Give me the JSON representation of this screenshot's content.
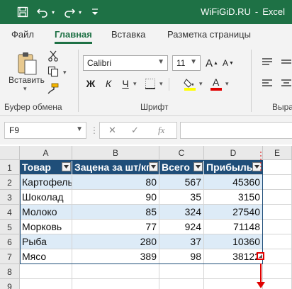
{
  "titlebar": {
    "app_name": "WiFiGiD.RU",
    "separator": "-",
    "program": "Excel"
  },
  "tabs": [
    "Файл",
    "Главная",
    "Вставка",
    "Разметка страницы"
  ],
  "ribbon": {
    "paste_label": "Вставить",
    "clipboard_group": "Буфер обмена",
    "font_group": "Шрифт",
    "align_group_partial": "Выра",
    "font_name": "Calibri",
    "font_size": "11",
    "bold": "Ж",
    "italic": "К",
    "underline": "Ч",
    "grow_font": "A",
    "shrink_font": "A"
  },
  "formula_bar": {
    "name_box": "F9",
    "fx": "fx",
    "cancel": "✕",
    "enter": "✓",
    "formula": ""
  },
  "grid": {
    "columns": [
      "A",
      "B",
      "C",
      "D",
      "E"
    ],
    "rows": [
      "1",
      "2",
      "3",
      "4",
      "5",
      "6",
      "7",
      "8",
      "9"
    ],
    "table_headers": [
      "Товар",
      "Зацена за шт/кг",
      "Всего",
      "Прибыль"
    ],
    "table_rows": [
      [
        "Картофель",
        "80",
        "567",
        "45360"
      ],
      [
        "Шоколад",
        "90",
        "35",
        "3150"
      ],
      [
        "Молоко",
        "85",
        "324",
        "27540"
      ],
      [
        "Морковь",
        "77",
        "924",
        "71148"
      ],
      [
        "Рыба",
        "280",
        "37",
        "10360"
      ],
      [
        "Мясо",
        "389",
        "98",
        "38122"
      ]
    ]
  },
  "colors": {
    "excel_green": "#1e7145",
    "table_header": "#1f4e79",
    "band": "#ddebf7",
    "annotation_arrow": "#e00000",
    "underline_red": "#e00000",
    "highlight_yellow": "#ffff00"
  },
  "icons": [
    "save-icon",
    "undo-icon",
    "redo-icon",
    "paste-icon",
    "cut-icon",
    "copy-icon",
    "format-painter-icon",
    "fill-color-icon",
    "font-color-icon",
    "border-icon",
    "filter-dropdown-icon",
    "annotation-arrow"
  ]
}
